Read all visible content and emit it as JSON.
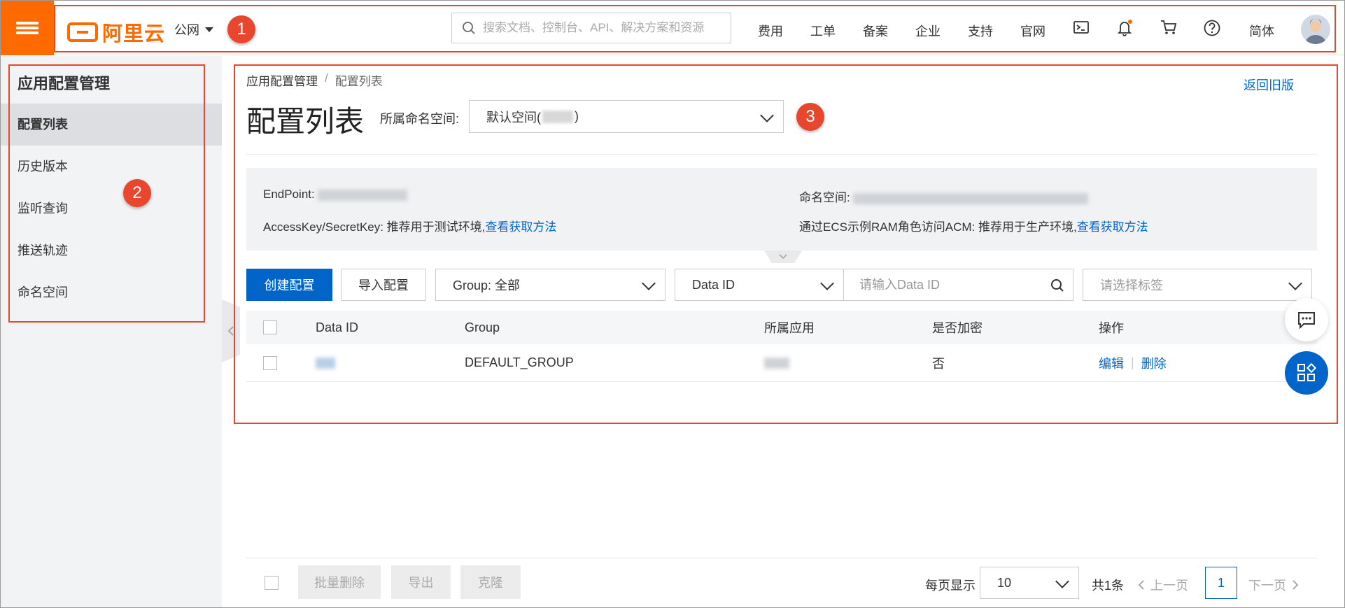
{
  "header": {
    "logo_text": "阿里云",
    "region": "公网",
    "search_placeholder": "搜索文档、控制台、API、解决方案和资源",
    "nav": [
      "费用",
      "工单",
      "备案",
      "企业",
      "支持",
      "官网"
    ],
    "language": "简体",
    "icons": [
      "terminal-icon",
      "bell-icon",
      "cart-icon",
      "help-icon"
    ],
    "accent_color": "#ff6a00"
  },
  "sidebar": {
    "title": "应用配置管理",
    "items": [
      {
        "label": "配置列表",
        "active": true
      },
      {
        "label": "历史版本",
        "active": false
      },
      {
        "label": "监听查询",
        "active": false
      },
      {
        "label": "推送轨迹",
        "active": false
      },
      {
        "label": "命名空间",
        "active": false
      }
    ]
  },
  "main": {
    "breadcrumb": [
      "应用配置管理",
      "/",
      "配置列表"
    ],
    "old_version_link": "返回旧版",
    "title": "配置列表",
    "namespace_label": "所属命名空间:",
    "namespace_value_prefix": "默认空间(",
    "namespace_value_suffix": ")",
    "info": {
      "endpoint_label": "EndPoint:",
      "namespace_label": "命名空间:",
      "accesskey_text": "AccessKey/SecretKey: 推荐用于测试环境,",
      "accesskey_link": "查看获取方法",
      "ecs_text": "通过ECS示例RAM角色访问ACM: 推荐用于生产环境,",
      "ecs_link": "查看获取方法"
    },
    "toolbar": {
      "create_button": "创建配置",
      "import_button": "导入配置",
      "group_select": "Group: 全部",
      "dataid_select": "Data ID",
      "dataid_placeholder": "请输入Data ID",
      "tag_placeholder": "请选择标签"
    },
    "table": {
      "columns": [
        "Data ID",
        "Group",
        "所属应用",
        "是否加密",
        "操作"
      ],
      "rows": [
        {
          "group": "DEFAULT_GROUP",
          "encrypted": "否",
          "ops": [
            "编辑",
            "删除"
          ]
        }
      ]
    },
    "footer": {
      "batch_delete": "批量删除",
      "export": "导出",
      "clone": "克隆",
      "page_size_label": "每页显示",
      "page_size": "10",
      "total": "共1条",
      "prev": "上一页",
      "page": "1",
      "next": "下一页"
    }
  },
  "annotations": [
    "1",
    "2",
    "3"
  ],
  "annotation_color": "#e8472e",
  "link_color": "#0064c8"
}
